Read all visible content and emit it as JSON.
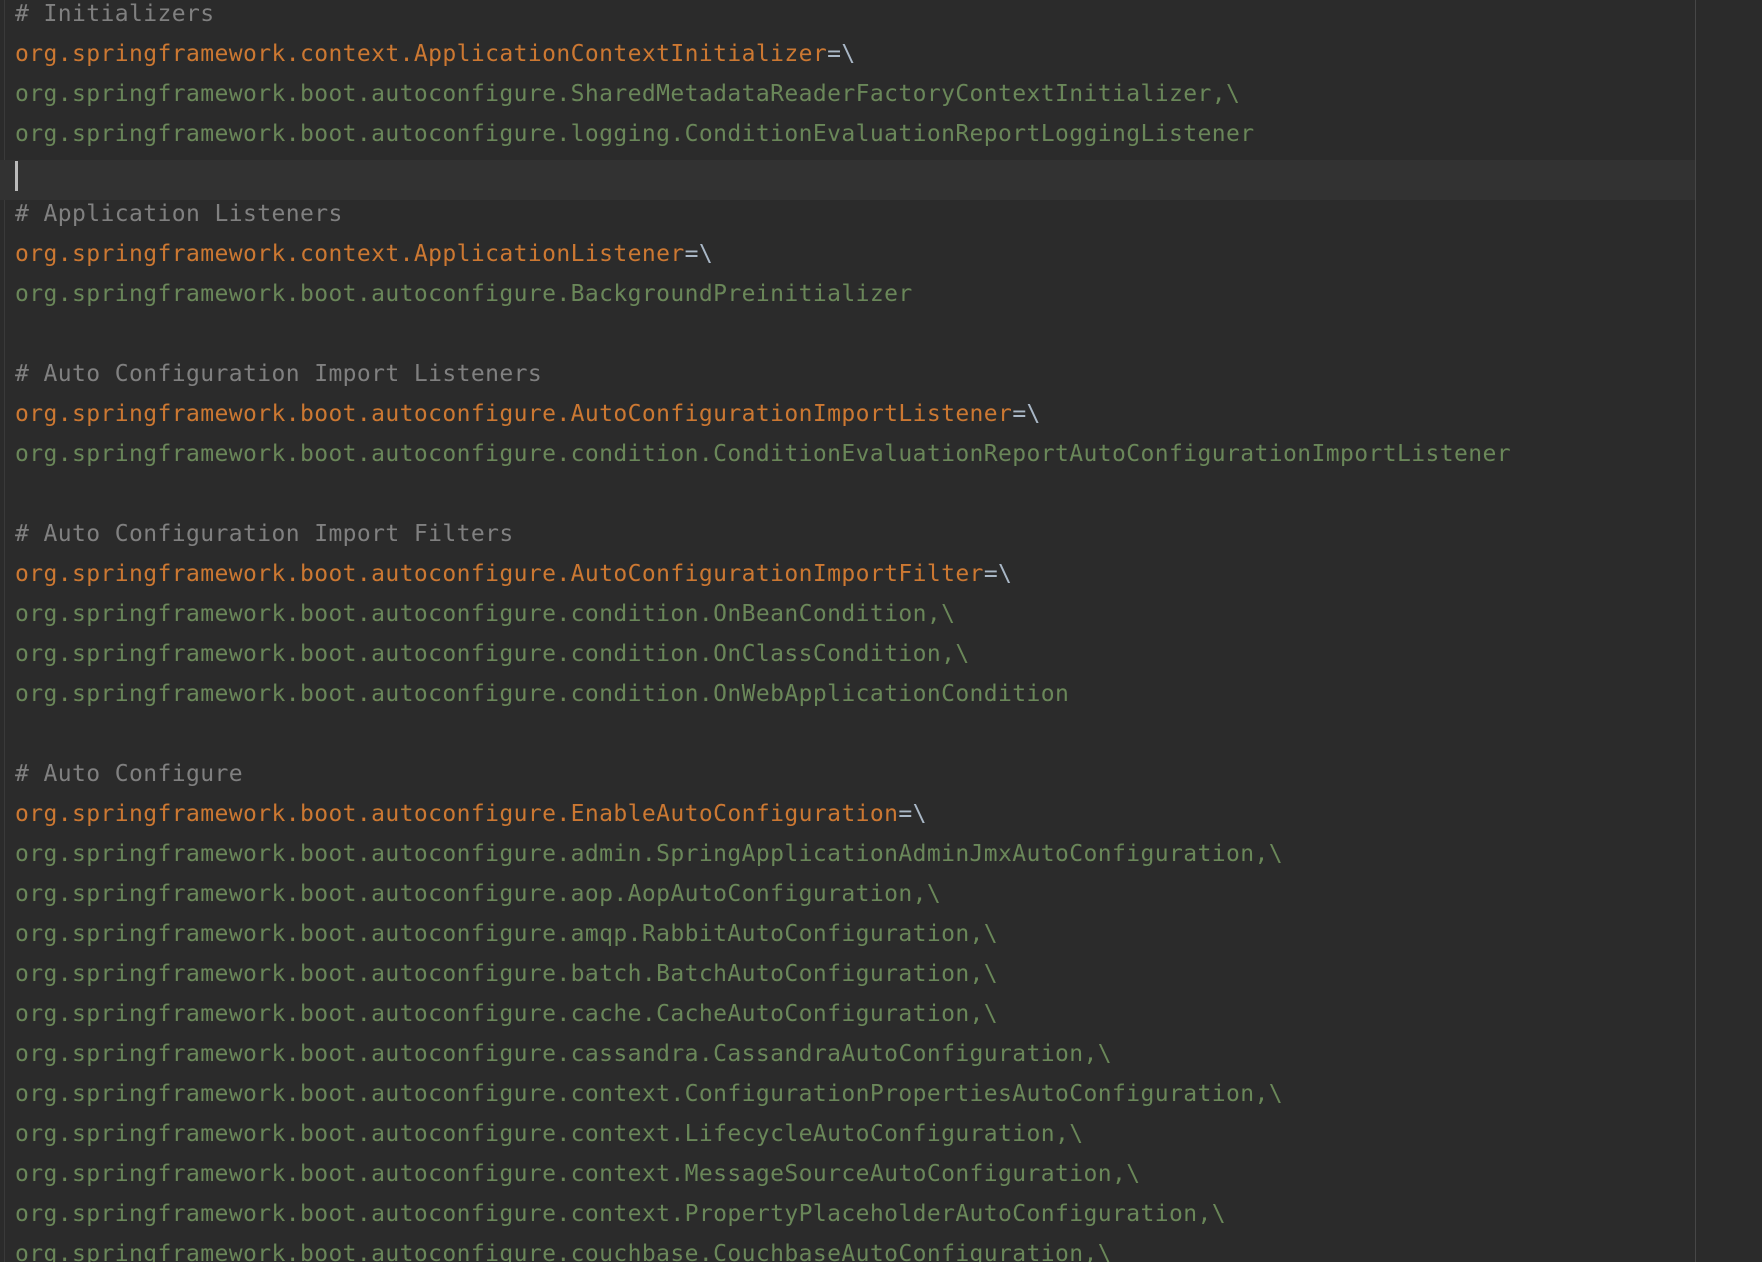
{
  "editor": {
    "lines": [
      {
        "type": "comment",
        "text": "# Initializers"
      },
      {
        "type": "key",
        "text": "org.springframework.context.ApplicationContextInitializer",
        "suffix": "=\\"
      },
      {
        "type": "value",
        "text": "org.springframework.boot.autoconfigure.SharedMetadataReaderFactoryContextInitializer,\\"
      },
      {
        "type": "value",
        "text": "org.springframework.boot.autoconfigure.logging.ConditionEvaluationReportLoggingListener"
      },
      {
        "type": "caret",
        "text": ""
      },
      {
        "type": "comment",
        "text": "# Application Listeners"
      },
      {
        "type": "key",
        "text": "org.springframework.context.ApplicationListener",
        "suffix": "=\\"
      },
      {
        "type": "value",
        "text": "org.springframework.boot.autoconfigure.BackgroundPreinitializer"
      },
      {
        "type": "blank",
        "text": ""
      },
      {
        "type": "comment",
        "text": "# Auto Configuration Import Listeners"
      },
      {
        "type": "key",
        "text": "org.springframework.boot.autoconfigure.AutoConfigurationImportListener",
        "suffix": "=\\"
      },
      {
        "type": "value",
        "text": "org.springframework.boot.autoconfigure.condition.ConditionEvaluationReportAutoConfigurationImportListener"
      },
      {
        "type": "blank",
        "text": ""
      },
      {
        "type": "comment",
        "text": "# Auto Configuration Import Filters"
      },
      {
        "type": "key",
        "text": "org.springframework.boot.autoconfigure.AutoConfigurationImportFilter",
        "suffix": "=\\"
      },
      {
        "type": "value",
        "text": "org.springframework.boot.autoconfigure.condition.OnBeanCondition,\\"
      },
      {
        "type": "value",
        "text": "org.springframework.boot.autoconfigure.condition.OnClassCondition,\\"
      },
      {
        "type": "value",
        "text": "org.springframework.boot.autoconfigure.condition.OnWebApplicationCondition"
      },
      {
        "type": "blank",
        "text": ""
      },
      {
        "type": "comment",
        "text": "# Auto Configure"
      },
      {
        "type": "key",
        "text": "org.springframework.boot.autoconfigure.EnableAutoConfiguration",
        "suffix": "=\\"
      },
      {
        "type": "value",
        "text": "org.springframework.boot.autoconfigure.admin.SpringApplicationAdminJmxAutoConfiguration,\\"
      },
      {
        "type": "value",
        "text": "org.springframework.boot.autoconfigure.aop.AopAutoConfiguration,\\"
      },
      {
        "type": "value",
        "text": "org.springframework.boot.autoconfigure.amqp.RabbitAutoConfiguration,\\"
      },
      {
        "type": "value",
        "text": "org.springframework.boot.autoconfigure.batch.BatchAutoConfiguration,\\"
      },
      {
        "type": "value",
        "text": "org.springframework.boot.autoconfigure.cache.CacheAutoConfiguration,\\"
      },
      {
        "type": "value",
        "text": "org.springframework.boot.autoconfigure.cassandra.CassandraAutoConfiguration,\\"
      },
      {
        "type": "value",
        "text": "org.springframework.boot.autoconfigure.context.ConfigurationPropertiesAutoConfiguration,\\"
      },
      {
        "type": "value",
        "text": "org.springframework.boot.autoconfigure.context.LifecycleAutoConfiguration,\\"
      },
      {
        "type": "value",
        "text": "org.springframework.boot.autoconfigure.context.MessageSourceAutoConfiguration,\\"
      },
      {
        "type": "value",
        "text": "org.springframework.boot.autoconfigure.context.PropertyPlaceholderAutoConfiguration,\\"
      },
      {
        "type": "value",
        "text": "org.springframework.boot.autoconfigure.couchbase.CouchbaseAutoConfiguration,\\"
      }
    ]
  },
  "colors": {
    "background": "#2b2b2b",
    "comment": "#808080",
    "key": "#cc7832",
    "value": "#6a8759",
    "operator": "#a9b7c6"
  }
}
